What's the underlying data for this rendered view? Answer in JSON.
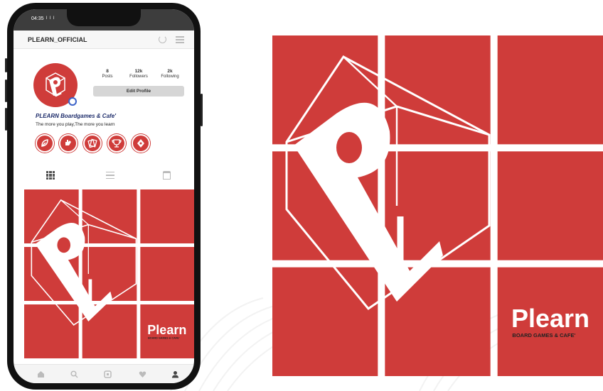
{
  "status": {
    "time": "04:35",
    "signal": "l l l"
  },
  "profile": {
    "username": "PLEARN_OFFICIAL",
    "display_name": "PLEARN Boardgames & Cafe'",
    "tagline": "The more you play,The more you learn",
    "edit_label": "Edit Profile",
    "stats": [
      {
        "num": "8",
        "label": "Posts"
      },
      {
        "num": "12k",
        "label": "Followers"
      },
      {
        "num": "2k",
        "label": "Following"
      }
    ],
    "highlight_icons": [
      "leaf-icon",
      "hand-icon",
      "cards-icon",
      "trophy-icon",
      "diamond-icon"
    ]
  },
  "brand": {
    "wordmark": "Plearn",
    "subline": "BOARD GAMES & CAFE'",
    "colors": {
      "red": "#cf3c3a",
      "white": "#ffffff",
      "navy": "#1e2d6b"
    }
  },
  "icons": {
    "tabs": [
      "grid-icon",
      "list-icon",
      "tagged-icon"
    ],
    "bottom_nav": [
      "home-icon",
      "search-icon",
      "reels-icon",
      "heart-icon",
      "profile-icon"
    ]
  }
}
